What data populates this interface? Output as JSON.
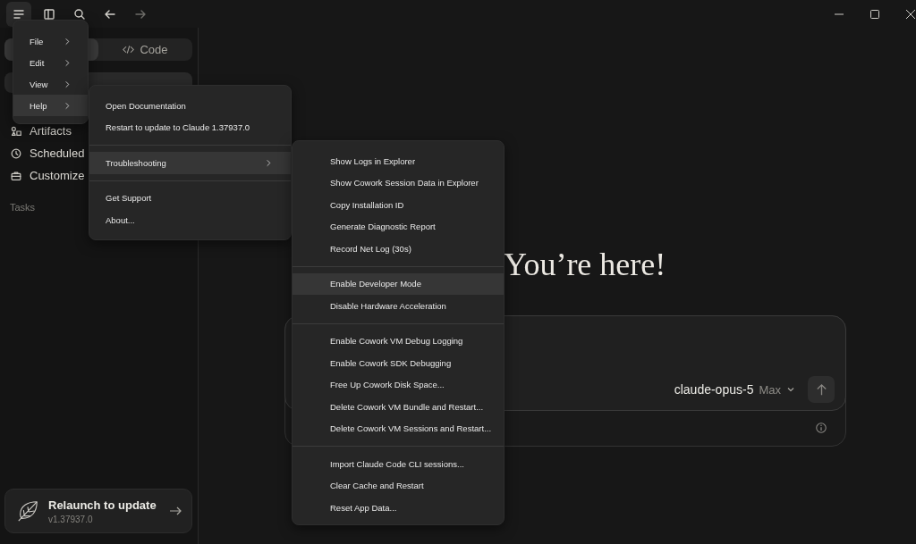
{
  "toolbar": {
    "buttons": [
      {
        "kind": "menu",
        "selected": true
      },
      {
        "kind": "sidebar"
      },
      {
        "kind": "search"
      },
      {
        "kind": "back"
      },
      {
        "kind": "forward",
        "disabled": true
      }
    ]
  },
  "sidebar": {
    "mode_tabs": [
      {
        "selected": true
      },
      {
        "label": "Code",
        "selected": false
      }
    ],
    "nav_items": [
      {
        "label": "Artifacts",
        "kind": "artifacts"
      },
      {
        "label": "Scheduled",
        "kind": "clock"
      },
      {
        "label": "Customize",
        "kind": "briefcase"
      }
    ],
    "section_label": "Tasks",
    "update_card": {
      "title": "Relaunch to update",
      "version": "v1.37937.0"
    }
  },
  "main": {
    "heading": "You’re here!",
    "composer": {
      "model": "claude-opus-5",
      "effort": "Max"
    }
  },
  "app_menu": {
    "items": [
      {
        "label": "File",
        "selected": false
      },
      {
        "label": "Edit",
        "selected": false
      },
      {
        "label": "View",
        "selected": false
      },
      {
        "label": "Help",
        "selected": true
      }
    ]
  },
  "help_menu": {
    "groups": [
      [
        {
          "label": "Open Documentation",
          "selected": false,
          "submenu": false
        },
        {
          "label": "Restart to update to Claude 1.37937.0",
          "selected": false,
          "submenu": false
        }
      ],
      [
        {
          "label": "Troubleshooting",
          "selected": true,
          "submenu": true
        }
      ],
      [
        {
          "label": "Get Support",
          "selected": false,
          "submenu": false
        },
        {
          "label": "About...",
          "selected": false,
          "submenu": false
        }
      ]
    ]
  },
  "troubleshooting_menu": {
    "groups": [
      [
        {
          "label": "Show Logs in Explorer",
          "selected": false
        },
        {
          "label": "Show Cowork Session Data in Explorer",
          "selected": false
        },
        {
          "label": "Copy Installation ID",
          "selected": false
        },
        {
          "label": "Generate Diagnostic Report",
          "selected": false
        },
        {
          "label": "Record Net Log (30s)",
          "selected": false
        }
      ],
      [
        {
          "label": "Enable Developer Mode",
          "selected": true
        },
        {
          "label": "Disable Hardware Acceleration",
          "selected": false
        }
      ],
      [
        {
          "label": "Enable Cowork VM Debug Logging",
          "selected": false
        },
        {
          "label": "Enable Cowork SDK Debugging",
          "selected": false
        },
        {
          "label": "Free Up Cowork Disk Space...",
          "selected": false
        },
        {
          "label": "Delete Cowork VM Bundle and Restart...",
          "selected": false
        },
        {
          "label": "Delete Cowork VM Sessions and Restart...",
          "selected": false
        }
      ],
      [
        {
          "label": "Import Claude Code CLI sessions...",
          "selected": false
        },
        {
          "label": "Clear Cache and Restart",
          "selected": false
        },
        {
          "label": "Reset App Data...",
          "selected": false
        }
      ]
    ]
  }
}
